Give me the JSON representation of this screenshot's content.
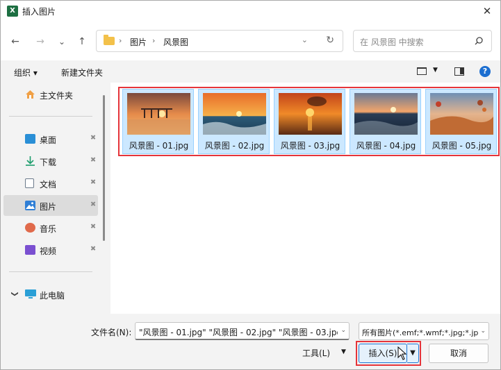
{
  "window": {
    "title": "插入图片",
    "app_icon_letter": "X",
    "close_glyph": "✕"
  },
  "nav": {
    "back_glyph": "←",
    "forward_glyph": "→",
    "recent_glyph": "⌄",
    "up_glyph": "↑",
    "breadcrumb": [
      "图片",
      "风景图"
    ],
    "separator": "›",
    "dropdown_glyph": "⌄",
    "refresh_glyph": "↻"
  },
  "search": {
    "placeholder": "在 风景图 中搜索"
  },
  "toolbar": {
    "organize": "组织 ▾",
    "new_folder": "新建文件夹",
    "view_dd": "▼",
    "help": "?"
  },
  "sidebar": {
    "home": "主文件夹",
    "items": [
      {
        "label": "桌面",
        "icon": "desktop-icon",
        "color": "#2a8fd6"
      },
      {
        "label": "下载",
        "icon": "download-icon",
        "color": "#1b9c6b"
      },
      {
        "label": "文档",
        "icon": "document-icon",
        "color": "#6b7a8a"
      },
      {
        "label": "图片",
        "icon": "pictures-icon",
        "color": "#2f7fd6"
      },
      {
        "label": "音乐",
        "icon": "music-icon",
        "color": "#e06a4b"
      },
      {
        "label": "视频",
        "icon": "video-icon",
        "color": "#7a4fd0"
      }
    ],
    "pin_glyph": "📌",
    "this_pc": "此电脑",
    "chevron": "❯"
  },
  "files": [
    {
      "name": "风景图 - 01.jpg",
      "theme": "pier-sunset"
    },
    {
      "name": "风景图 - 02.jpg",
      "theme": "wave-sunset"
    },
    {
      "name": "风景图 - 03.jpg",
      "theme": "cloud-sunset"
    },
    {
      "name": "风景图 - 04.jpg",
      "theme": "sea-sunset"
    },
    {
      "name": "风景图 - 05.jpg",
      "theme": "desert-balloons"
    }
  ],
  "bottom": {
    "filename_label": "文件名(N):",
    "filename_value": "\"风景图 - 01.jpg\" \"风景图 - 02.jpg\" \"风景图 - 03.jpg",
    "filetype_value": "所有图片(*.emf;*.wmf;*.jpg;*.jp",
    "tools_label": "工具(L)",
    "insert_label": "插入(S)",
    "cancel_label": "取消",
    "dd_glyph": "▼",
    "select_glyph": "⌄"
  },
  "colors": {
    "selection_highlight": "#e5343a",
    "item_selected_bg": "#cce8ff",
    "accent": "#1c75d4"
  }
}
